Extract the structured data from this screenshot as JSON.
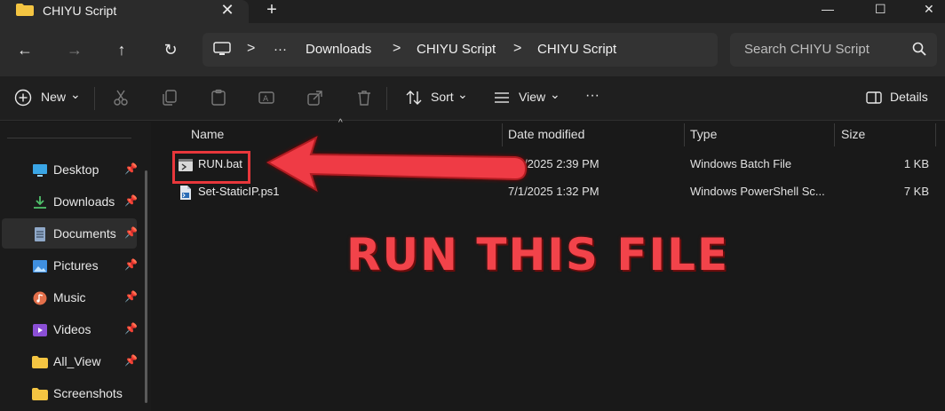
{
  "window": {
    "tab_title": "CHIYU Script",
    "close_tab_glyph": "✕",
    "new_tab_glyph": "+",
    "controls": [
      "—",
      "☐",
      "✕"
    ]
  },
  "nav": {
    "back_glyph": "←",
    "forward_glyph": "→",
    "up_glyph": "↑",
    "refresh_glyph": "↻",
    "breadcrumb_more": "···",
    "crumb_separator": ">",
    "crumbs": [
      "Downloads",
      "CHIYU Script",
      "CHIYU Script"
    ],
    "search_placeholder": "Search CHIYU Script"
  },
  "toolbar": {
    "new_label": "New",
    "sort_label": "Sort",
    "view_label": "View",
    "more_glyph": "···",
    "details_label": "Details",
    "chevron": "⌄"
  },
  "sidebar": {
    "pin_glyph": "📌",
    "items": [
      {
        "label": "Desktop",
        "icon": "desktop-icon",
        "pinned": true,
        "active": false
      },
      {
        "label": "Downloads",
        "icon": "downloads-icon",
        "pinned": true,
        "active": false
      },
      {
        "label": "Documents",
        "icon": "documents-icon",
        "pinned": true,
        "active": true
      },
      {
        "label": "Pictures",
        "icon": "pictures-icon",
        "pinned": true,
        "active": false
      },
      {
        "label": "Music",
        "icon": "music-icon",
        "pinned": true,
        "active": false
      },
      {
        "label": "Videos",
        "icon": "videos-icon",
        "pinned": true,
        "active": false
      },
      {
        "label": "All_View",
        "icon": "folder-icon",
        "pinned": true,
        "active": false
      },
      {
        "label": "Screenshots",
        "icon": "folder-icon",
        "pinned": false,
        "active": false
      }
    ]
  },
  "list": {
    "columns": [
      "Name",
      "Date modified",
      "Type",
      "Size"
    ],
    "sort_caret": "^",
    "rows": [
      {
        "name": "RUN.bat",
        "date": "7/1/2025 2:39 PM",
        "type": "Windows Batch File",
        "size": "1 KB",
        "icon": "batch-file-icon"
      },
      {
        "name": "Set-StaticIP.ps1",
        "date": "7/1/2025 1:32 PM",
        "type": "Windows PowerShell Sc...",
        "size": "7 KB",
        "icon": "powershell-file-icon"
      }
    ]
  },
  "annotation": {
    "text": "RUN THIS FILE",
    "color": "#f2434a"
  },
  "colors": {
    "accent_folder": "#f4c542",
    "highlight": "#e8373b"
  }
}
